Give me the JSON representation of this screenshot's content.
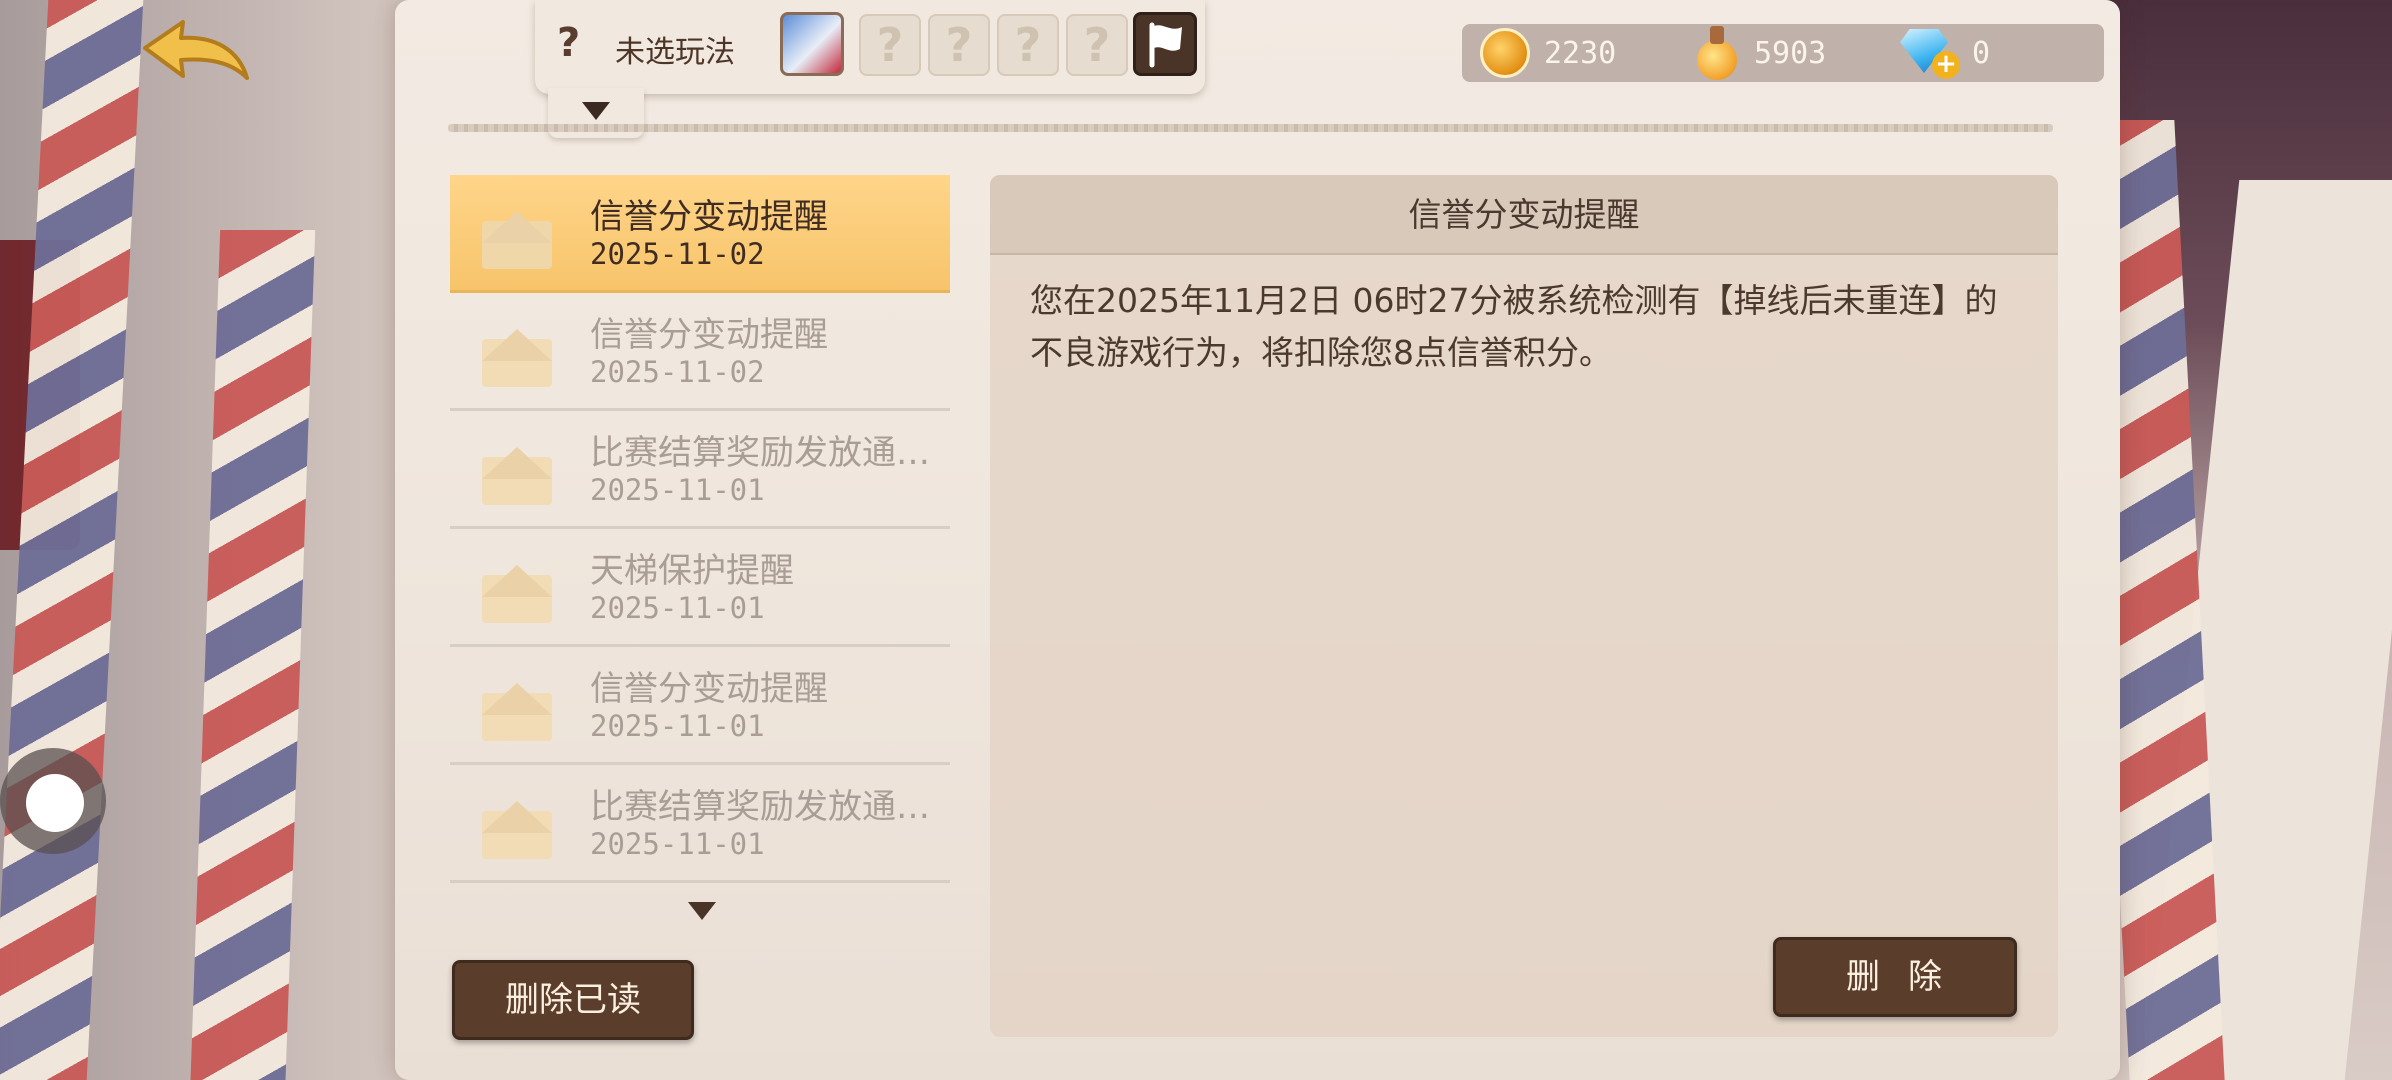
{
  "top_bar": {
    "mode_question_mark": "?",
    "mode_label": "未选玩法",
    "empty_slot_glyph": "?",
    "empty_slot_count": 4
  },
  "currency": {
    "gold": {
      "icon": "gold-coin-icon",
      "value": "2230"
    },
    "potion": {
      "icon": "potion-icon",
      "value": "5903"
    },
    "diamond": {
      "icon": "diamond-plus-icon",
      "value": "0"
    }
  },
  "mail_list": {
    "items": [
      {
        "title": "信誉分变动提醒",
        "date": "2025-11-02",
        "selected": true
      },
      {
        "title": "信誉分变动提醒",
        "date": "2025-11-02",
        "selected": false
      },
      {
        "title": "比赛结算奖励发放通…",
        "date": "2025-11-01",
        "selected": false
      },
      {
        "title": "天梯保护提醒",
        "date": "2025-11-01",
        "selected": false
      },
      {
        "title": "信誉分变动提醒",
        "date": "2025-11-01",
        "selected": false
      },
      {
        "title": "比赛结算奖励发放通…",
        "date": "2025-11-01",
        "selected": false
      }
    ],
    "delete_read_label": "删除已读"
  },
  "detail": {
    "title": "信誉分变动提醒",
    "body": "您在2025年11月2日 06时27分被系统检测有【掉线后未重连】的不良游戏行为，将扣除您8点信誉积分。",
    "delete_label": "删除"
  },
  "colors": {
    "selected_mail": "#f7c46a",
    "button_dark": "#5b3d2b",
    "paper": "#efe6dd"
  }
}
